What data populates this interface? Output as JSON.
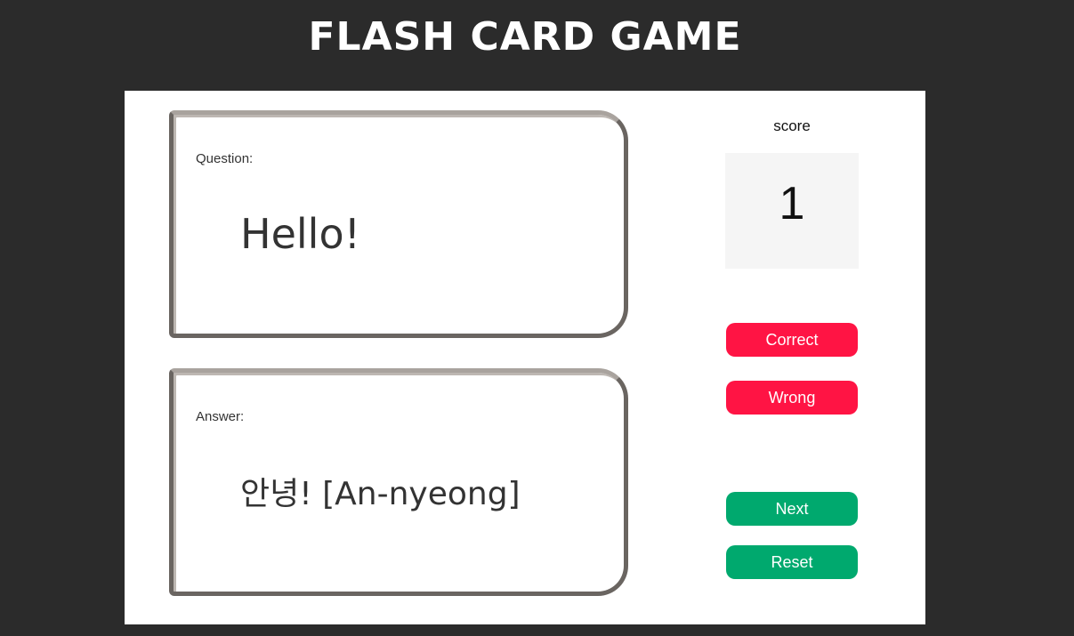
{
  "header": {
    "title": "Flash Card Game"
  },
  "question_card": {
    "label": "Question:",
    "text": "Hello!"
  },
  "answer_card": {
    "label": "Answer:",
    "text": "안녕! [An-nyeong]"
  },
  "score": {
    "label": "score",
    "value": "1"
  },
  "buttons": {
    "correct": "Correct",
    "wrong": "Wrong",
    "next": "Next",
    "reset": "Reset"
  },
  "colors": {
    "background": "#2b2b2b",
    "panel": "#ffffff",
    "red_button": "#ff1444",
    "green_button": "#00a96e",
    "score_box": "#f5f5f5",
    "card_border": "#6a6561"
  }
}
